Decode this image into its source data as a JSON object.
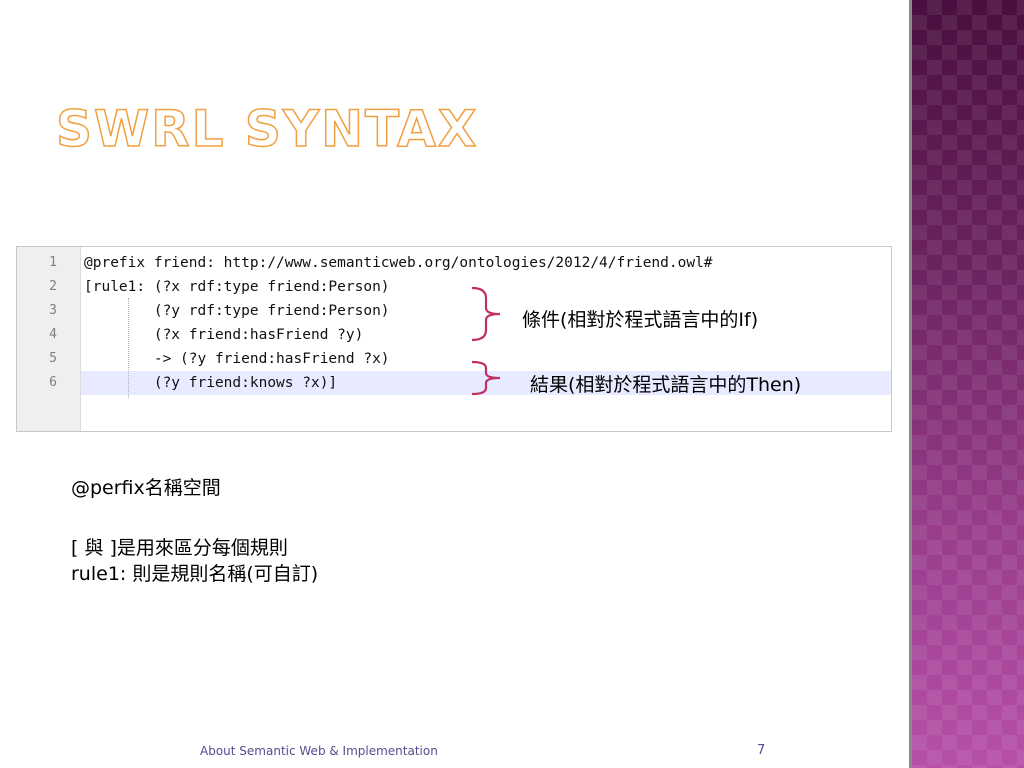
{
  "slide": {
    "title": "SWRL Syntax",
    "page_number": "7",
    "footer": "About Semantic Web & Implementation"
  },
  "code": {
    "lines": [
      {
        "num": "1",
        "text": "@prefix friend: http://www.semanticweb.org/ontologies/2012/4/friend.owl#"
      },
      {
        "num": "2",
        "text": "[rule1: (?x rdf:type friend:Person)"
      },
      {
        "num": "3",
        "text": "        (?y rdf:type friend:Person)"
      },
      {
        "num": "4",
        "text": "        (?x friend:hasFriend ?y)"
      },
      {
        "num": "5",
        "text": "        -> (?y friend:hasFriend ?x)"
      },
      {
        "num": "6",
        "text": "        (?y friend:knows ?x)]"
      }
    ],
    "highlighted_line": "6"
  },
  "annotations": {
    "condition": "條件(相對於程式語言中的If)",
    "result": "結果(相對於程式語言中的Then)",
    "brace_color": "#c03060"
  },
  "notes": {
    "prefix": "@perfix名稱空間",
    "brackets": "[ 與 ]是用來區分每個規則",
    "rule_name": "rule1: 則是規則名稱(可自訂)"
  },
  "theme": {
    "title_outline": "#f0a040",
    "side_band": "#6b2360"
  }
}
